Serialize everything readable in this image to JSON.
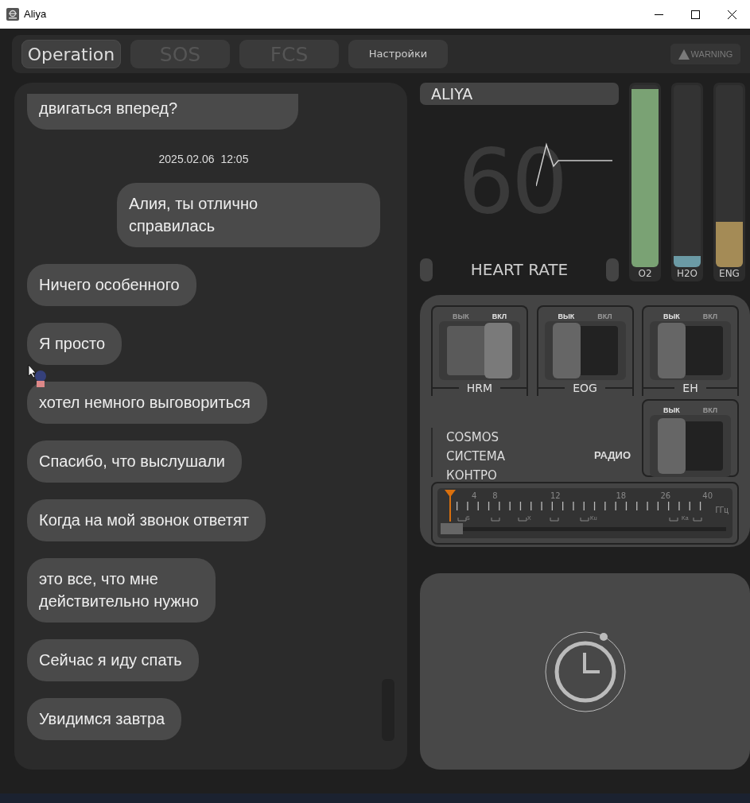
{
  "window": {
    "title": "Aliya"
  },
  "tabs": [
    {
      "label": "Operation",
      "selected": true,
      "disabled": false
    },
    {
      "label": "SOS",
      "selected": false,
      "disabled": true
    },
    {
      "label": "FCS",
      "selected": false,
      "disabled": true
    },
    {
      "label": "Настройки",
      "selected": false,
      "disabled": false
    }
  ],
  "warning": {
    "label": "WARNING",
    "disabled": true
  },
  "chat": {
    "messages": [
      {
        "kind": "received",
        "text": "двигаться вперед?"
      },
      {
        "kind": "timestamp",
        "text": "2025.02.06  12:05"
      },
      {
        "kind": "sent",
        "text": "Алия, ты отлично\nсправилась"
      },
      {
        "kind": "received",
        "text": "Ничего особенного"
      },
      {
        "kind": "received",
        "text": "Я просто"
      },
      {
        "kind": "received",
        "text": "хотел немного выговориться"
      },
      {
        "kind": "received",
        "text": "Спасибо, что выслушали"
      },
      {
        "kind": "received",
        "text": "Когда на мой звонок ответят"
      },
      {
        "kind": "received",
        "text": "это все, что мне\nдействительно нужно"
      },
      {
        "kind": "received",
        "text": "Сейчас я иду спать"
      },
      {
        "kind": "received",
        "text": "Увидимся завтра"
      }
    ]
  },
  "vitals": {
    "name": "ALIYA",
    "heart_rate": "60",
    "label": "HEART RATE"
  },
  "gauges": [
    {
      "label": "O2",
      "level": 0.98,
      "color": "#7aa274"
    },
    {
      "label": "H2O",
      "level": 0.06,
      "color": "#6b9aa5"
    },
    {
      "label": "ENG",
      "level": 0.25,
      "color": "#a48b56"
    }
  ],
  "switches": [
    {
      "label": "HRM",
      "off_label": "ВЫК",
      "on_label": "ВКЛ",
      "on": true
    },
    {
      "label": "EOG",
      "off_label": "ВЫК",
      "on_label": "ВКЛ",
      "on": false
    },
    {
      "label": "EH",
      "off_label": "ВЫК",
      "on_label": "ВКЛ",
      "on": false
    }
  ],
  "radio": {
    "lines": [
      "COSMOS",
      "СИСТЕМА",
      "КОНТРО"
    ],
    "label": "РАДИО",
    "switch": {
      "off_label": "ВЫК",
      "on_label": "ВКЛ",
      "on": false
    },
    "scale": {
      "ticks": [
        "4",
        "8",
        "12",
        "18",
        "26",
        "40"
      ],
      "unit": "ГГц",
      "bands": [
        "S",
        "X",
        "Ku",
        "Ka"
      ],
      "level": 0
    }
  }
}
